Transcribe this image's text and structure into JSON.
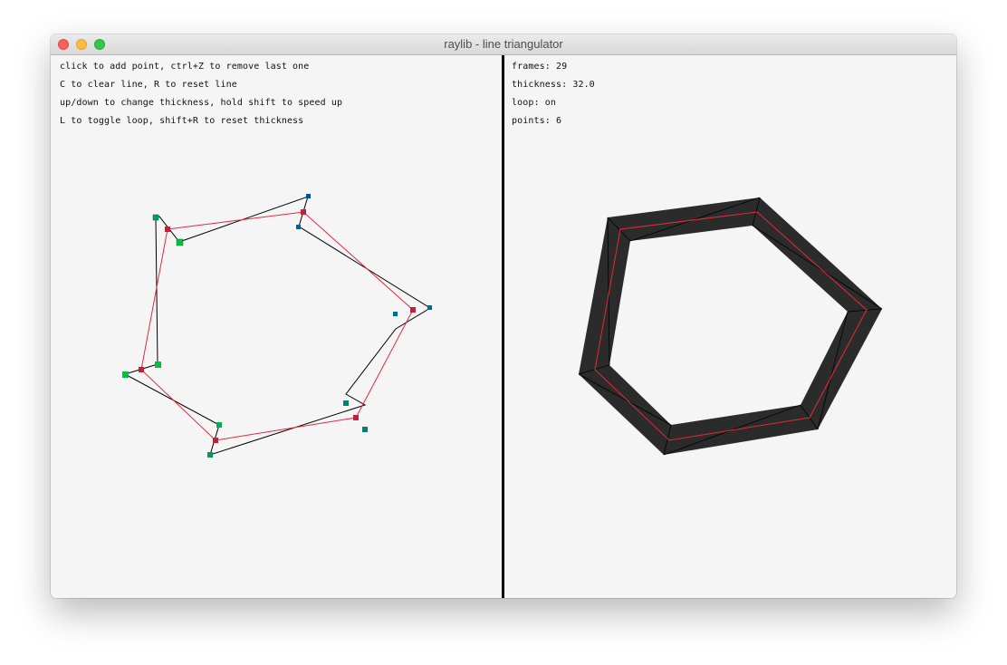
{
  "window": {
    "title": "raylib - line triangulator"
  },
  "instructions": [
    "click to add point, ctrl+Z to remove last one",
    "C to clear line, R to reset line",
    "up/down to change thickness, hold shift to speed up",
    "L to toggle loop, shift+R to reset thickness"
  ],
  "stats": {
    "frames": "frames: 29",
    "thickness": "thickness: 32.0",
    "loop": "loop: on",
    "points": "points: 6"
  },
  "colors": {
    "background": "#f5f5f5",
    "center_line": "#e6293a",
    "control_point": "#be2138",
    "outline": "#000000",
    "mesh_fill": "#2b2b2b",
    "handle_colors": [
      "#00c040",
      "#00b050",
      "#009070",
      "#007080",
      "#0050a0"
    ]
  }
}
